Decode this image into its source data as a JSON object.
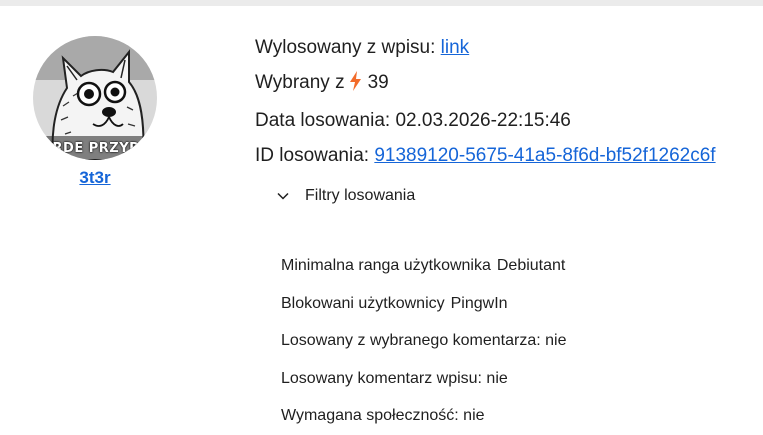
{
  "user": {
    "avatar_caption": "URDE PRZYPA",
    "username": "3t3r"
  },
  "details": {
    "from_entry_label": "Wylosowany z wpisu:",
    "from_entry_link": "link",
    "chosen_from_label": "Wybrany z",
    "chosen_from_count": "39",
    "date_label": "Data losowania:",
    "date_value": "02.03.2026-22:15:46",
    "id_label": "ID losowania:",
    "id_value": "91389120-5675-41a5-8f6d-bf52f1262c6f"
  },
  "filters": {
    "title": "Filtry losowania",
    "expanded": true,
    "items": [
      {
        "label": "Minimalna ranga użytkownika",
        "value": "Debiutant"
      },
      {
        "label": "Blokowani użytkownicy",
        "value": "PingwIn"
      },
      {
        "label": "Losowany z wybranego komentarza: nie",
        "value": ""
      },
      {
        "label": "Losowany komentarz wpisu: nie",
        "value": ""
      },
      {
        "label": "Wymagana społeczność: nie",
        "value": ""
      }
    ]
  },
  "icons": {
    "bolt": "lightning-bolt-icon",
    "chevron": "chevron-down-icon"
  },
  "colors": {
    "link": "#1565d8",
    "bolt": "#f26b2a",
    "top_border": "#ebebeb"
  }
}
